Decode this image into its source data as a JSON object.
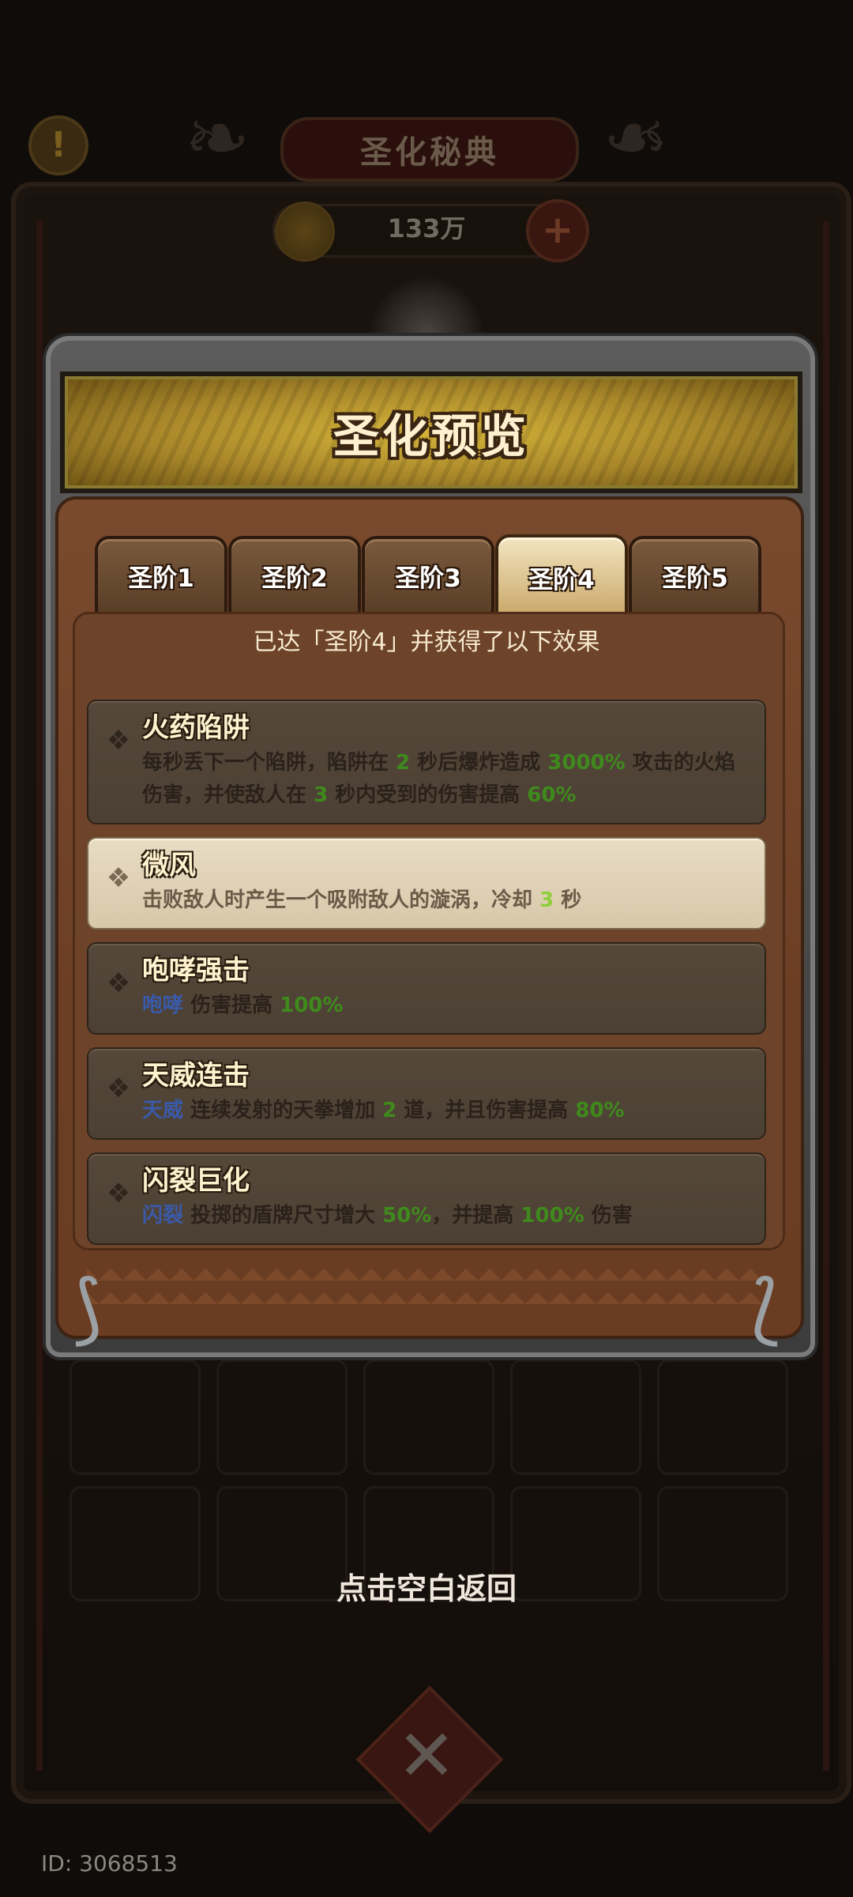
{
  "background": {
    "title": "圣化秘典",
    "currency_amount": "133万",
    "info_icon": "exclamation-icon",
    "plus_icon": "plus-icon",
    "close_icon": "close-x-icon"
  },
  "modal": {
    "title": "圣化预览",
    "tabs": [
      {
        "label": "圣阶1"
      },
      {
        "label": "圣阶2"
      },
      {
        "label": "圣阶3"
      },
      {
        "label": "圣阶4",
        "active": true
      },
      {
        "label": "圣阶5"
      }
    ],
    "header": "已达「圣阶4」并获得了以下效果",
    "effects": [
      {
        "title": "火药陷阱",
        "desc_parts": [
          {
            "t": "每秒丢下一个陷阱，陷阱在 "
          },
          {
            "t": "2",
            "c": "g"
          },
          {
            "t": " 秒后爆炸造成 "
          },
          {
            "t": "3000%",
            "c": "g"
          },
          {
            "t": " 攻击的火焰伤害，并使敌人在 "
          },
          {
            "t": "3",
            "c": "g"
          },
          {
            "t": " 秒内受到的伤害提高 "
          },
          {
            "t": "60%",
            "c": "g"
          }
        ]
      },
      {
        "title": "微风",
        "highlight": true,
        "desc_parts": [
          {
            "t": "击败敌人时产生一个吸附敌人的漩涡，冷却 "
          },
          {
            "t": "3",
            "c": "g"
          },
          {
            "t": " 秒"
          }
        ]
      },
      {
        "title": "咆哮强击",
        "desc_parts": [
          {
            "t": "咆哮",
            "c": "b"
          },
          {
            "t": " 伤害提高 "
          },
          {
            "t": "100%",
            "c": "g"
          }
        ]
      },
      {
        "title": "天威连击",
        "desc_parts": [
          {
            "t": "天威",
            "c": "b"
          },
          {
            "t": " 连续发射的天拳增加 "
          },
          {
            "t": "2",
            "c": "g"
          },
          {
            "t": " 道，并且伤害提高 "
          },
          {
            "t": "80%",
            "c": "g"
          }
        ]
      },
      {
        "title": "闪裂巨化",
        "desc_parts": [
          {
            "t": "闪裂",
            "c": "b"
          },
          {
            "t": " 投掷的盾牌尺寸增大 "
          },
          {
            "t": "50%",
            "c": "g"
          },
          {
            "t": "，并提高 "
          },
          {
            "t": "100%",
            "c": "g"
          },
          {
            "t": " 伤害"
          }
        ]
      }
    ]
  },
  "return_hint": "点击空白返回",
  "id_label": "ID: 3068513"
}
